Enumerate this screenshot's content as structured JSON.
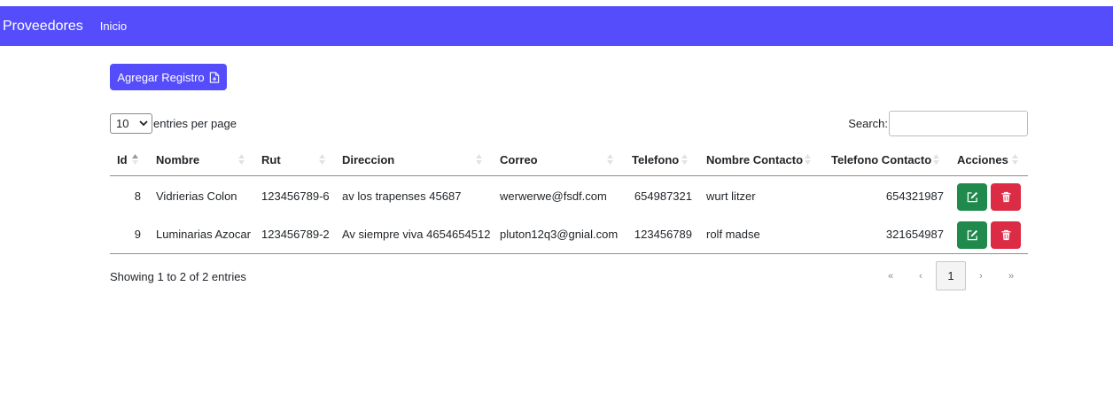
{
  "navbar": {
    "brand": "Proveedores",
    "link": "Inicio"
  },
  "add_button": {
    "label": "Agregar Registro",
    "icon": "file-plus-icon"
  },
  "entries": {
    "selected": "10",
    "label": "entries per page"
  },
  "search": {
    "label": "Search:",
    "value": ""
  },
  "table": {
    "headers": [
      "Id",
      "Nombre",
      "Rut",
      "Direccion",
      "Correo",
      "Telefono",
      "Nombre Contacto",
      "Telefono Contacto",
      "Acciones"
    ],
    "rows": [
      {
        "id": "8",
        "nombre": "Vidrierias Colon",
        "rut": "123456789-6",
        "direccion": "av los trapenses 45687",
        "correo": "werwerwe@fsdf.com",
        "telefono": "654987321",
        "nombre_contacto": "wurt litzer",
        "telefono_contacto": "654321987"
      },
      {
        "id": "9",
        "nombre": "Luminarias Azocar",
        "rut": "123456789-2",
        "direccion": "Av siempre viva 4654654512",
        "correo": "pluton12q3@gnial.com",
        "telefono": "123456789",
        "nombre_contacto": "rolf madse",
        "telefono_contacto": "321654987"
      }
    ]
  },
  "info": "Showing 1 to 2 of 2 entries",
  "pagination": {
    "first": "«",
    "prev": "‹",
    "current": "1",
    "next": "›",
    "last": "»"
  },
  "colors": {
    "primary": "#554dfb",
    "edit": "#1f8a4c",
    "delete": "#dc2b45"
  }
}
